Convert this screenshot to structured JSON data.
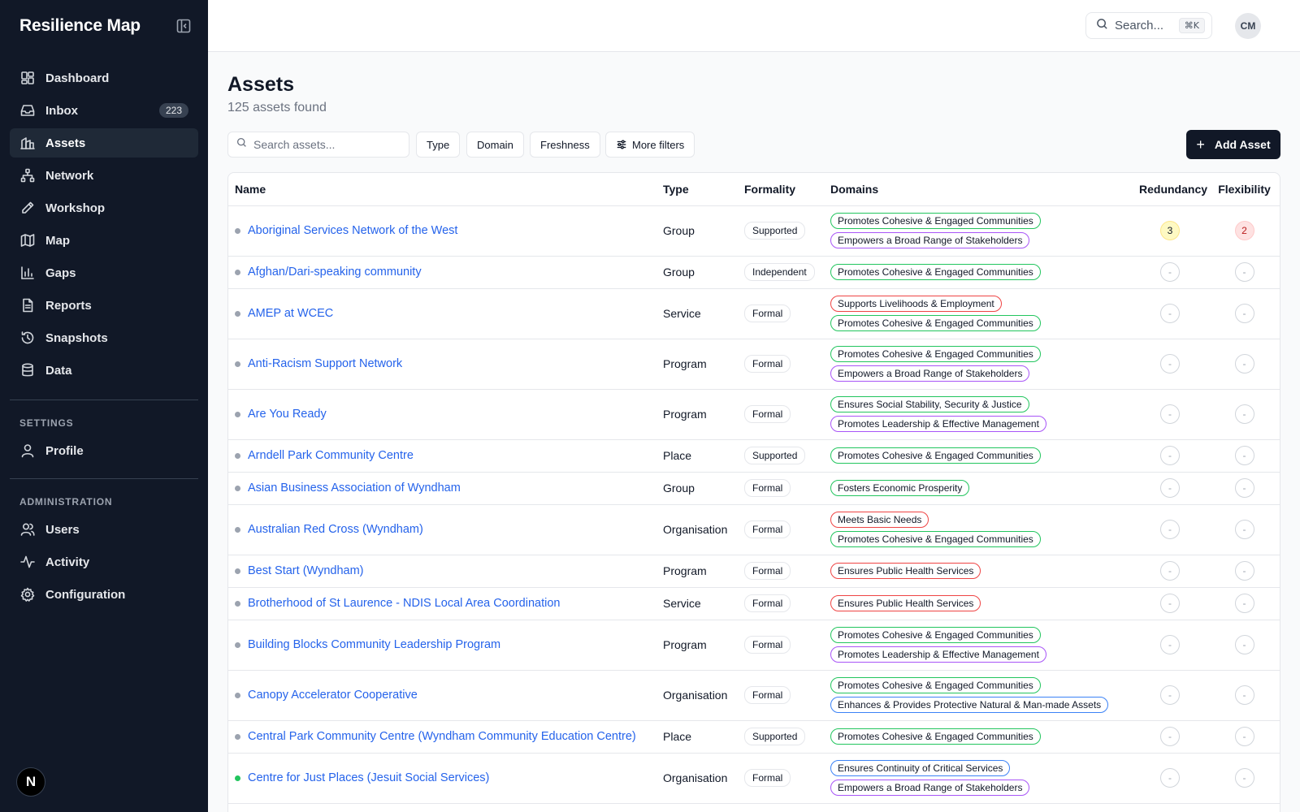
{
  "app": {
    "title": "Resilience Map"
  },
  "sidebar": {
    "nav": [
      {
        "label": "Dashboard",
        "icon": "dashboard-icon"
      },
      {
        "label": "Inbox",
        "icon": "inbox-icon",
        "badge": "223"
      },
      {
        "label": "Assets",
        "icon": "assets-icon",
        "active": true
      },
      {
        "label": "Network",
        "icon": "network-icon"
      },
      {
        "label": "Workshop",
        "icon": "pencil-icon"
      },
      {
        "label": "Map",
        "icon": "map-icon"
      },
      {
        "label": "Gaps",
        "icon": "bar-chart-icon"
      },
      {
        "label": "Reports",
        "icon": "file-icon"
      },
      {
        "label": "Snapshots",
        "icon": "history-icon"
      },
      {
        "label": "Data",
        "icon": "database-icon"
      }
    ],
    "settings_title": "SETTINGS",
    "settings": [
      {
        "label": "Profile",
        "icon": "user-icon"
      }
    ],
    "admin_title": "ADMINISTRATION",
    "admin": [
      {
        "label": "Users",
        "icon": "users-icon"
      },
      {
        "label": "Activity",
        "icon": "activity-icon"
      },
      {
        "label": "Configuration",
        "icon": "gear-icon"
      }
    ],
    "footer_logo": "N"
  },
  "header": {
    "search_placeholder": "Search...",
    "shortcut": "⌘K",
    "avatar": "CM"
  },
  "page": {
    "title": "Assets",
    "subtitle": "125 assets found",
    "search_placeholder": "Search assets...",
    "filters": [
      "Type",
      "Domain",
      "Freshness",
      "More filters"
    ],
    "add_label": "Add Asset"
  },
  "colors": {
    "green": "#22c55e",
    "purple": "#a855f7",
    "red": "#ef4444",
    "blue": "#3b82f6"
  },
  "table": {
    "columns": [
      "Name",
      "Type",
      "Formality",
      "Domains",
      "Redundancy",
      "Flexibility"
    ],
    "rows": [
      {
        "name": "Aboriginal Services Network of the West",
        "type": "Group",
        "formality": "Supported",
        "domains": [
          [
            "Promotes Cohesive & Engaged Communities",
            "green"
          ],
          [
            "Empowers a Broad Range of Stakeholders",
            "purple"
          ]
        ],
        "redundancy": "3",
        "flexibility": "2"
      },
      {
        "name": "Afghan/Dari-speaking community",
        "type": "Group",
        "formality": "Independent",
        "domains": [
          [
            "Promotes Cohesive & Engaged Communities",
            "green"
          ]
        ],
        "redundancy": "-",
        "flexibility": "-"
      },
      {
        "name": "AMEP at WCEC",
        "type": "Service",
        "formality": "Formal",
        "domains": [
          [
            "Supports Livelihoods & Employment",
            "red"
          ],
          [
            "Promotes Cohesive & Engaged Communities",
            "green"
          ]
        ],
        "redundancy": "-",
        "flexibility": "-"
      },
      {
        "name": "Anti-Racism Support Network",
        "type": "Program",
        "formality": "Formal",
        "domains": [
          [
            "Promotes Cohesive & Engaged Communities",
            "green"
          ],
          [
            "Empowers a Broad Range of Stakeholders",
            "purple"
          ]
        ],
        "redundancy": "-",
        "flexibility": "-"
      },
      {
        "name": "Are You Ready",
        "type": "Program",
        "formality": "Formal",
        "domains": [
          [
            "Ensures Social Stability, Security & Justice",
            "green"
          ],
          [
            "Promotes Leadership & Effective Management",
            "purple"
          ]
        ],
        "redundancy": "-",
        "flexibility": "-"
      },
      {
        "name": "Arndell Park Community Centre",
        "type": "Place",
        "formality": "Supported",
        "domains": [
          [
            "Promotes Cohesive & Engaged Communities",
            "green"
          ]
        ],
        "redundancy": "-",
        "flexibility": "-"
      },
      {
        "name": "Asian Business Association of Wyndham",
        "type": "Group",
        "formality": "Formal",
        "domains": [
          [
            "Fosters Economic Prosperity",
            "green"
          ]
        ],
        "redundancy": "-",
        "flexibility": "-"
      },
      {
        "name": "Australian Red Cross (Wyndham)",
        "type": "Organisation",
        "formality": "Formal",
        "domains": [
          [
            "Meets Basic Needs",
            "red"
          ],
          [
            "Promotes Cohesive & Engaged Communities",
            "green"
          ]
        ],
        "redundancy": "-",
        "flexibility": "-"
      },
      {
        "name": "Best Start (Wyndham)",
        "type": "Program",
        "formality": "Formal",
        "domains": [
          [
            "Ensures Public Health Services",
            "red"
          ]
        ],
        "redundancy": "-",
        "flexibility": "-"
      },
      {
        "name": "Brotherhood of St Laurence - NDIS Local Area Coordination",
        "type": "Service",
        "formality": "Formal",
        "domains": [
          [
            "Ensures Public Health Services",
            "red"
          ]
        ],
        "redundancy": "-",
        "flexibility": "-"
      },
      {
        "name": "Building Blocks Community Leadership Program",
        "type": "Program",
        "formality": "Formal",
        "domains": [
          [
            "Promotes Cohesive & Engaged Communities",
            "green"
          ],
          [
            "Promotes Leadership & Effective Management",
            "purple"
          ]
        ],
        "redundancy": "-",
        "flexibility": "-"
      },
      {
        "name": "Canopy Accelerator Cooperative",
        "type": "Organisation",
        "formality": "Formal",
        "domains": [
          [
            "Promotes Cohesive & Engaged Communities",
            "green"
          ],
          [
            "Enhances & Provides Protective Natural & Man-made Assets",
            "blue"
          ]
        ],
        "redundancy": "-",
        "flexibility": "-"
      },
      {
        "name": "Central Park Community Centre (Wyndham Community Education Centre)",
        "type": "Place",
        "formality": "Supported",
        "domains": [
          [
            "Promotes Cohesive & Engaged Communities",
            "green"
          ]
        ],
        "redundancy": "-",
        "flexibility": "-"
      },
      {
        "name": "Centre for Just Places (Jesuit Social Services)",
        "type": "Organisation",
        "formality": "Formal",
        "status": "green",
        "domains": [
          [
            "Ensures Continuity of Critical Services",
            "blue"
          ],
          [
            "Empowers a Broad Range of Stakeholders",
            "purple"
          ]
        ],
        "redundancy": "-",
        "flexibility": "-"
      }
    ]
  }
}
